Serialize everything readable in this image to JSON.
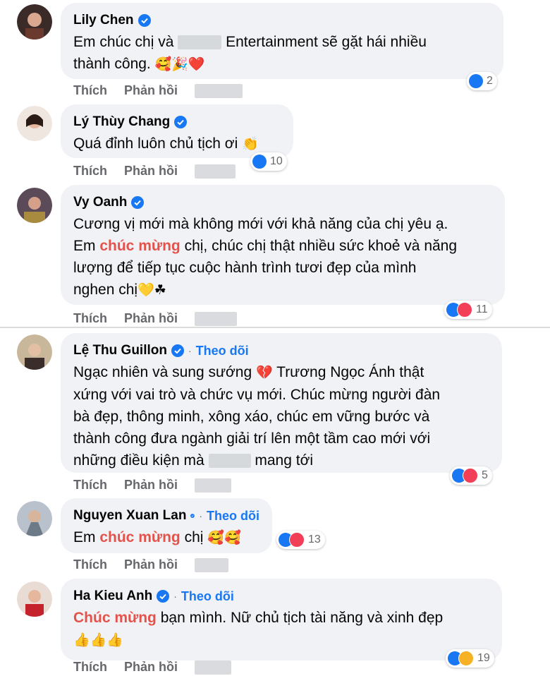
{
  "actions": {
    "like": "Thích",
    "reply": "Phản hồi"
  },
  "follow_label": "Theo dõi",
  "comments": [
    {
      "name": "Lily Chen",
      "text_before": "Em chúc chị và",
      "text_after": "Entertainment sẽ gặt hái nhiều",
      "line2": "thành công.",
      "emojis": "🥰🎉❤️",
      "reactions": "2"
    },
    {
      "name": "Lý Thùy Chang",
      "text": "Quá đỉnh luôn chủ tịch ơi",
      "emojis": "👏",
      "reactions": "10"
    },
    {
      "name": "Vy Oanh",
      "line1": "Cương vị mới mà không mới với khả năng của chị yêu ạ.",
      "line2_prefix": "Em",
      "line2_hl": "chúc mừng",
      "line2_suffix": "chị, chúc chị thật nhiều sức khoẻ và năng",
      "line3": "lượng để tiếp tục cuộc hành trình tươi đẹp của mình",
      "line4": "nghen chị",
      "emojis": "💛☘",
      "reactions": "11"
    },
    {
      "name": "Lệ Thu Guillon",
      "line1_prefix": "Ngạc nhiên và sung sướng",
      "line1_emoji": "💔",
      "line1_suffix": "Trương Ngọc Ánh thật",
      "line2": "xứng với vai trò và chức vụ mới. Chúc mừng người đàn",
      "line3": "bà đẹp, thông minh, xông xáo, chúc em vững bước và",
      "line4": "thành công đưa ngành giải trí lên một tầm cao mới với",
      "line5_prefix": "những điều kiện mà",
      "line5_suffix": "mang tới",
      "reactions": "5"
    },
    {
      "name": "Nguyen Xuan Lan",
      "text_prefix": "Em",
      "text_hl": "chúc mừng",
      "text_suffix": "chị",
      "emojis": "🥰🥰",
      "reactions": "13"
    },
    {
      "name": "Ha Kieu Anh",
      "text_hl": "Chúc mừng",
      "text_suffix": "bạn mình. Nữ chủ tịch tài năng và xinh đẹp",
      "emojis": "👍👍👍",
      "reactions": "19"
    }
  ]
}
